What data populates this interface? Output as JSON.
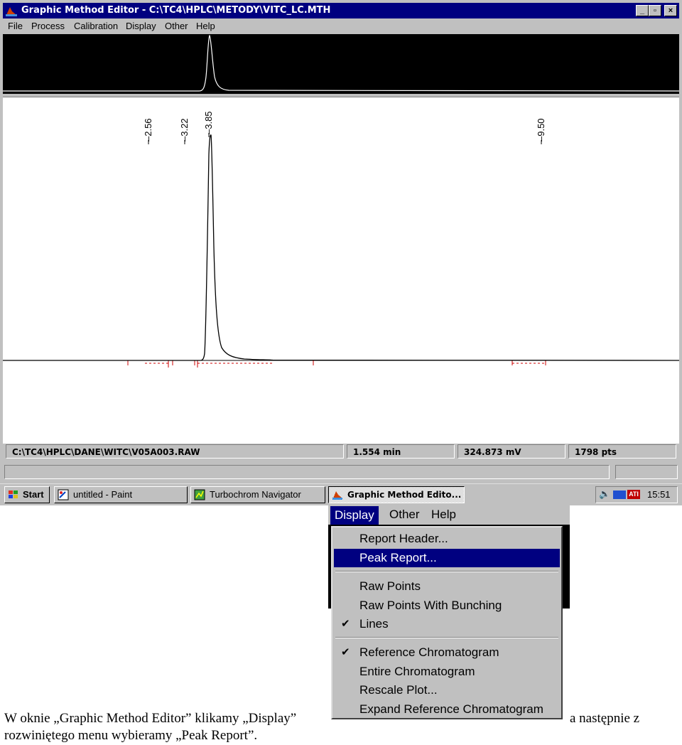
{
  "window": {
    "title": "Graphic Method Editor  - C:\\TC4\\HPLC\\METODY\\VITC_LC.MTH",
    "menu": [
      "File",
      "Process",
      "Calibration",
      "Display",
      "Other",
      "Help"
    ]
  },
  "plot": {
    "peak_labels": [
      "2.56",
      "3.22",
      "3.85",
      "9.50"
    ]
  },
  "status": {
    "file": "C:\\TC4\\HPLC\\DANE\\WITC\\V05A003.RAW",
    "time": "1.554 min",
    "signal": "324.873 mV",
    "points": "1798 pts"
  },
  "taskbar": {
    "start": "Start",
    "items": [
      "untitled - Paint",
      "Turbochrom Navigator",
      "Graphic Method Edito..."
    ],
    "clock": "15:51"
  },
  "overlay_menu": {
    "menubar": [
      "Display",
      "Other",
      "Help"
    ],
    "items": [
      {
        "label": "Report Header...",
        "checked": false
      },
      {
        "label": "Peak Report...",
        "checked": false,
        "highlighted": true
      },
      {
        "label": "Raw Points",
        "checked": false
      },
      {
        "label": "Raw Points With Bunching",
        "checked": false
      },
      {
        "label": "Lines",
        "checked": true
      },
      {
        "label": "Reference Chromatogram",
        "checked": true
      },
      {
        "label": "Entire Chromatogram",
        "checked": false
      },
      {
        "label": "Rescale Plot...",
        "checked": false
      },
      {
        "label": "Expand Reference Chromatogram",
        "checked": false
      }
    ]
  },
  "document": {
    "line1_left": "W oknie „Graphic  Method Editor” klikamy „Display”",
    "line1_right": "a następnie z",
    "line2": "rozwiniętego menu wybieramy „Peak Report”."
  },
  "colors": {
    "titlebar": "#000080",
    "baseline": "#cc0000",
    "highlight": "#000080"
  }
}
